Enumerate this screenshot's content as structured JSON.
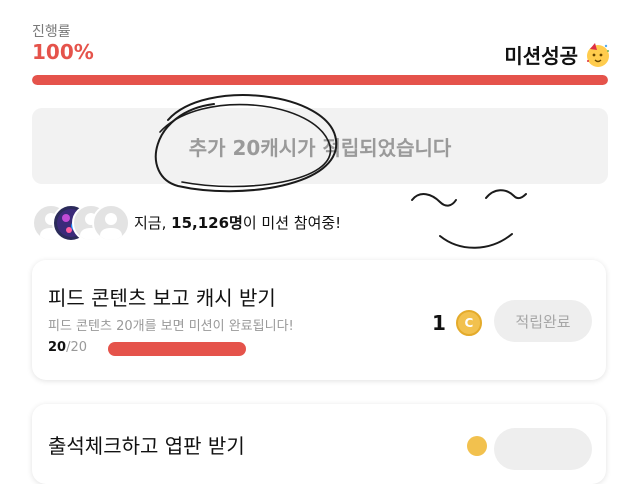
{
  "progress": {
    "label": "진행률",
    "percent_text": "100%",
    "value": 1.0,
    "status_text": "미션성공",
    "status_icon": "party-face-icon",
    "accent_color": "#e5534b"
  },
  "bonus": {
    "text": "추가 20캐시가 적립되었습니다"
  },
  "participants": {
    "prefix": "지금, ",
    "count": "15,126명",
    "suffix": "이 미션 참여중!"
  },
  "missions": [
    {
      "title": "피드 콘텐츠 보고 캐시 받기",
      "description": "피드 콘텐츠 20개를 보면 미션이 완료됩니다!",
      "progress_current": "20",
      "progress_total": "/20",
      "reward_amount": "1",
      "reward_icon": "cash-coin-icon",
      "button_label": "적립완료"
    },
    {
      "title": "출석체크하고 엽판 받기"
    }
  ]
}
